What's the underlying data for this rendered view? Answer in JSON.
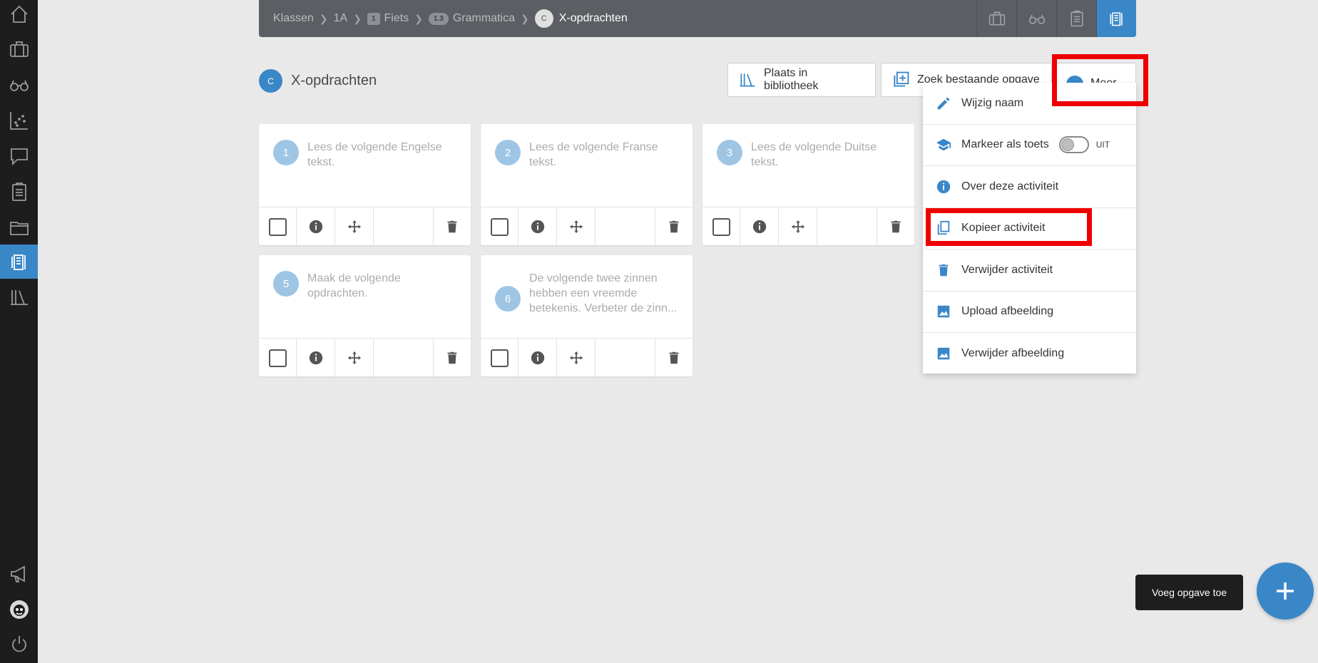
{
  "breadcrumb": {
    "items": [
      {
        "label": "Klassen"
      },
      {
        "label": "1A"
      },
      {
        "badge": "1",
        "label": "Fiets"
      },
      {
        "badge": "1.3",
        "label": "Grammatica"
      },
      {
        "badge": "C",
        "label": "X-opdrachten"
      }
    ]
  },
  "heading": {
    "badge": "C",
    "title": "X-opdrachten"
  },
  "actions": {
    "library_label": "Plaats in bibliotheek",
    "search_label": "Zoek bestaande opgave",
    "more_label": "Meer"
  },
  "cards": [
    {
      "num": "1",
      "text": "Lees de volgende Engelse tekst."
    },
    {
      "num": "2",
      "text": "Lees de volgende Franse tekst."
    },
    {
      "num": "3",
      "text": "Lees de volgende Duitse tekst."
    },
    {
      "num": "5",
      "text": "Maak de volgende opdrachten."
    },
    {
      "num": "6",
      "text": "De volgende twee zinnen hebben een vreemde betekenis. Verbeter de zinn..."
    }
  ],
  "menu": {
    "items": [
      {
        "label": "Wijzig naam",
        "icon": "pencil-icon"
      },
      {
        "label": "Markeer als toets",
        "icon": "graduation-cap-icon",
        "toggle": "UIT"
      },
      {
        "label": "Over deze activiteit",
        "icon": "info-icon"
      },
      {
        "label": "Kopieer activiteit",
        "icon": "copy-icon"
      },
      {
        "label": "Verwijder activiteit",
        "icon": "trash-icon"
      },
      {
        "label": "Upload afbeelding",
        "icon": "image-icon"
      },
      {
        "label": "Verwijder afbeelding",
        "icon": "image-icon"
      }
    ]
  },
  "fab": {
    "tooltip": "Voeg opgave toe"
  },
  "colors": {
    "accent": "#3a87c8",
    "sidebar": "#1d1d1d",
    "topbar": "#5b5f63",
    "highlight": "#ee0000"
  }
}
